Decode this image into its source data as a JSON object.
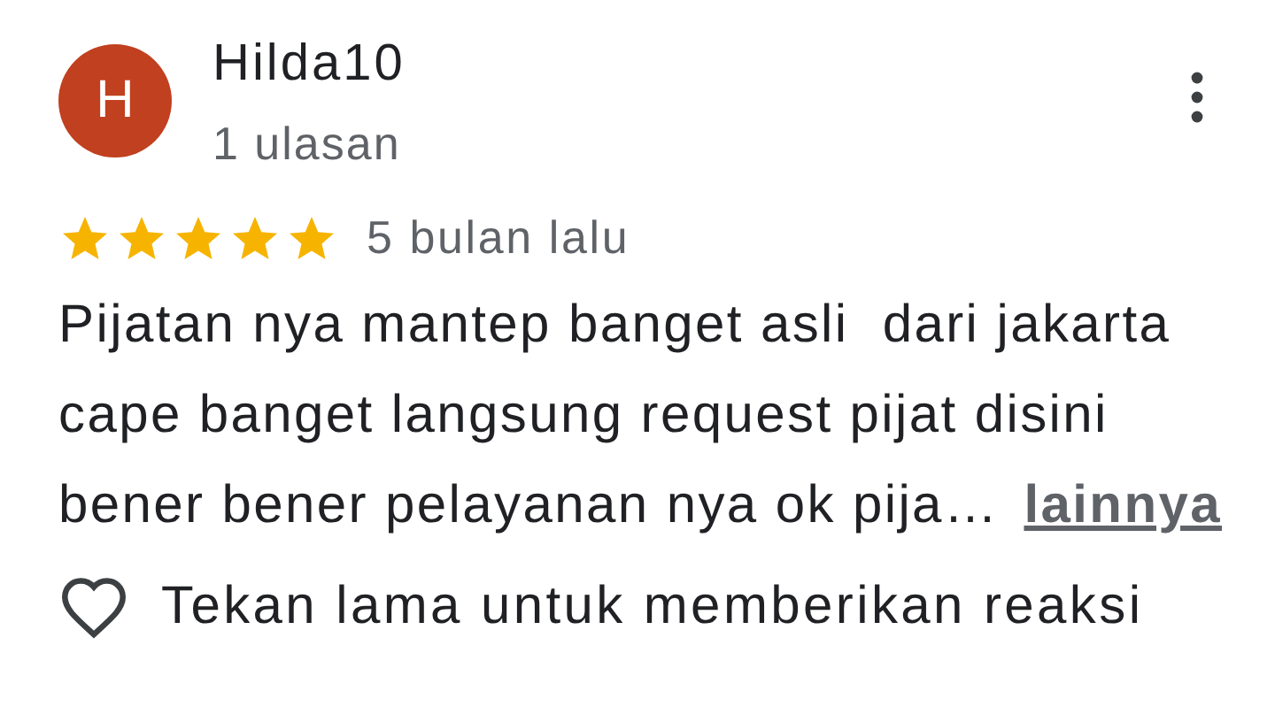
{
  "reviewer": {
    "initial": "H",
    "name": "Hilda10",
    "review_count": "1 ulasan"
  },
  "rating": {
    "stars": 5,
    "time": "5 bulan lalu"
  },
  "review": {
    "lines": [
      "Pijatan nya mantep banget asli  dari jakarta",
      "cape banget langsung request pijat disini",
      "bener bener pelayanan nya ok pija…"
    ],
    "more_link": "lainnya"
  },
  "reaction": {
    "liked": false,
    "label": "Tekan lama untuk memberikan reaksi"
  }
}
